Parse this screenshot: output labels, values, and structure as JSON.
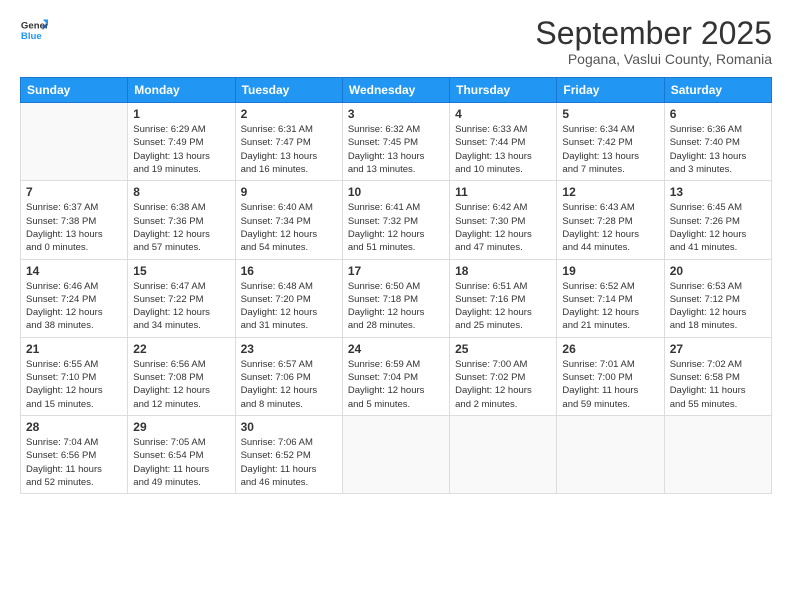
{
  "header": {
    "logo_line1": "General",
    "logo_line2": "Blue",
    "month": "September 2025",
    "location": "Pogana, Vaslui County, Romania"
  },
  "days_of_week": [
    "Sunday",
    "Monday",
    "Tuesday",
    "Wednesday",
    "Thursday",
    "Friday",
    "Saturday"
  ],
  "weeks": [
    [
      {
        "day": "",
        "info": ""
      },
      {
        "day": "1",
        "info": "Sunrise: 6:29 AM\nSunset: 7:49 PM\nDaylight: 13 hours\nand 19 minutes."
      },
      {
        "day": "2",
        "info": "Sunrise: 6:31 AM\nSunset: 7:47 PM\nDaylight: 13 hours\nand 16 minutes."
      },
      {
        "day": "3",
        "info": "Sunrise: 6:32 AM\nSunset: 7:45 PM\nDaylight: 13 hours\nand 13 minutes."
      },
      {
        "day": "4",
        "info": "Sunrise: 6:33 AM\nSunset: 7:44 PM\nDaylight: 13 hours\nand 10 minutes."
      },
      {
        "day": "5",
        "info": "Sunrise: 6:34 AM\nSunset: 7:42 PM\nDaylight: 13 hours\nand 7 minutes."
      },
      {
        "day": "6",
        "info": "Sunrise: 6:36 AM\nSunset: 7:40 PM\nDaylight: 13 hours\nand 3 minutes."
      }
    ],
    [
      {
        "day": "7",
        "info": "Sunrise: 6:37 AM\nSunset: 7:38 PM\nDaylight: 13 hours\nand 0 minutes."
      },
      {
        "day": "8",
        "info": "Sunrise: 6:38 AM\nSunset: 7:36 PM\nDaylight: 12 hours\nand 57 minutes."
      },
      {
        "day": "9",
        "info": "Sunrise: 6:40 AM\nSunset: 7:34 PM\nDaylight: 12 hours\nand 54 minutes."
      },
      {
        "day": "10",
        "info": "Sunrise: 6:41 AM\nSunset: 7:32 PM\nDaylight: 12 hours\nand 51 minutes."
      },
      {
        "day": "11",
        "info": "Sunrise: 6:42 AM\nSunset: 7:30 PM\nDaylight: 12 hours\nand 47 minutes."
      },
      {
        "day": "12",
        "info": "Sunrise: 6:43 AM\nSunset: 7:28 PM\nDaylight: 12 hours\nand 44 minutes."
      },
      {
        "day": "13",
        "info": "Sunrise: 6:45 AM\nSunset: 7:26 PM\nDaylight: 12 hours\nand 41 minutes."
      }
    ],
    [
      {
        "day": "14",
        "info": "Sunrise: 6:46 AM\nSunset: 7:24 PM\nDaylight: 12 hours\nand 38 minutes."
      },
      {
        "day": "15",
        "info": "Sunrise: 6:47 AM\nSunset: 7:22 PM\nDaylight: 12 hours\nand 34 minutes."
      },
      {
        "day": "16",
        "info": "Sunrise: 6:48 AM\nSunset: 7:20 PM\nDaylight: 12 hours\nand 31 minutes."
      },
      {
        "day": "17",
        "info": "Sunrise: 6:50 AM\nSunset: 7:18 PM\nDaylight: 12 hours\nand 28 minutes."
      },
      {
        "day": "18",
        "info": "Sunrise: 6:51 AM\nSunset: 7:16 PM\nDaylight: 12 hours\nand 25 minutes."
      },
      {
        "day": "19",
        "info": "Sunrise: 6:52 AM\nSunset: 7:14 PM\nDaylight: 12 hours\nand 21 minutes."
      },
      {
        "day": "20",
        "info": "Sunrise: 6:53 AM\nSunset: 7:12 PM\nDaylight: 12 hours\nand 18 minutes."
      }
    ],
    [
      {
        "day": "21",
        "info": "Sunrise: 6:55 AM\nSunset: 7:10 PM\nDaylight: 12 hours\nand 15 minutes."
      },
      {
        "day": "22",
        "info": "Sunrise: 6:56 AM\nSunset: 7:08 PM\nDaylight: 12 hours\nand 12 minutes."
      },
      {
        "day": "23",
        "info": "Sunrise: 6:57 AM\nSunset: 7:06 PM\nDaylight: 12 hours\nand 8 minutes."
      },
      {
        "day": "24",
        "info": "Sunrise: 6:59 AM\nSunset: 7:04 PM\nDaylight: 12 hours\nand 5 minutes."
      },
      {
        "day": "25",
        "info": "Sunrise: 7:00 AM\nSunset: 7:02 PM\nDaylight: 12 hours\nand 2 minutes."
      },
      {
        "day": "26",
        "info": "Sunrise: 7:01 AM\nSunset: 7:00 PM\nDaylight: 11 hours\nand 59 minutes."
      },
      {
        "day": "27",
        "info": "Sunrise: 7:02 AM\nSunset: 6:58 PM\nDaylight: 11 hours\nand 55 minutes."
      }
    ],
    [
      {
        "day": "28",
        "info": "Sunrise: 7:04 AM\nSunset: 6:56 PM\nDaylight: 11 hours\nand 52 minutes."
      },
      {
        "day": "29",
        "info": "Sunrise: 7:05 AM\nSunset: 6:54 PM\nDaylight: 11 hours\nand 49 minutes."
      },
      {
        "day": "30",
        "info": "Sunrise: 7:06 AM\nSunset: 6:52 PM\nDaylight: 11 hours\nand 46 minutes."
      },
      {
        "day": "",
        "info": ""
      },
      {
        "day": "",
        "info": ""
      },
      {
        "day": "",
        "info": ""
      },
      {
        "day": "",
        "info": ""
      }
    ]
  ]
}
